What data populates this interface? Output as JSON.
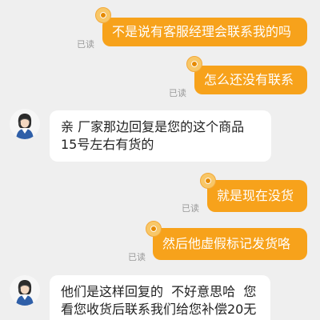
{
  "messages": [
    {
      "id": "m1",
      "direction": "outgoing",
      "text": "不是说有客服经理会联系我的吗",
      "status": "已读"
    },
    {
      "id": "m2",
      "direction": "outgoing",
      "text": "怎么还没有联系",
      "status": "已读"
    },
    {
      "id": "m3",
      "direction": "incoming",
      "lines": [
        "亲 厂家那边回复是您的这个商品",
        "15号左右有货的"
      ]
    },
    {
      "id": "m4",
      "direction": "outgoing",
      "text": "就是现在没货",
      "status": "已读"
    },
    {
      "id": "m5",
      "direction": "outgoing",
      "text": "然后他虚假标记发货咯",
      "status": "已读"
    },
    {
      "id": "m6",
      "direction": "incoming",
      "lines": [
        "他们是这样回复的  不好意思哈  您",
        "看您收货后联系我们给您补偿20无"
      ]
    }
  ],
  "colors": {
    "background": "#efefef",
    "outgoing_bubble": "#f7a21b",
    "incoming_bubble": "#ffffff",
    "read_status": "#9a9a9a"
  },
  "icons": {
    "outgoing_badge": "coin-badge-icon",
    "agent_avatar": "agent-avatar-icon"
  }
}
